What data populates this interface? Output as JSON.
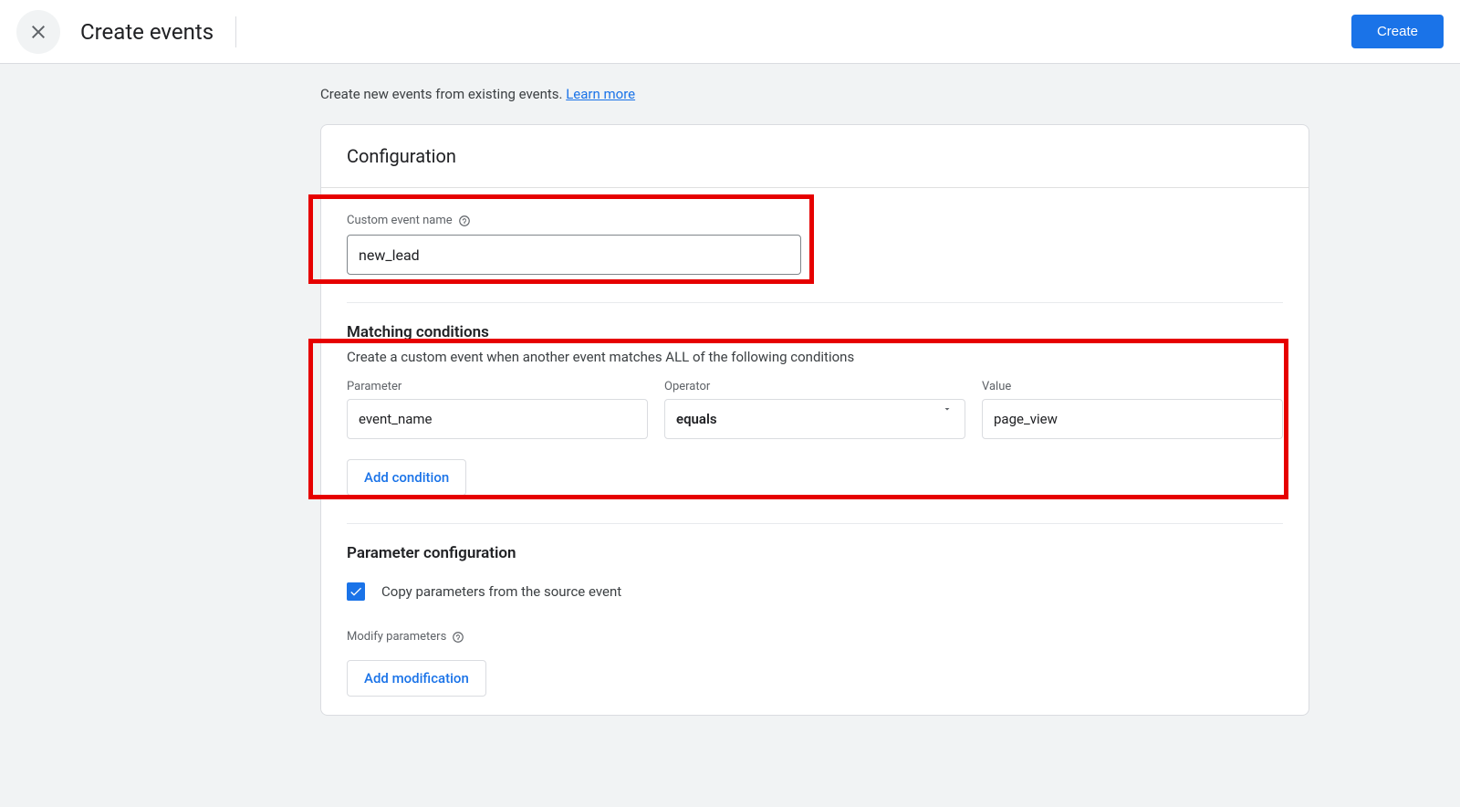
{
  "header": {
    "title": "Create events",
    "create_button": "Create"
  },
  "intro": {
    "text": "Create new events from existing events. ",
    "learn_more": "Learn more"
  },
  "card": {
    "title": "Configuration",
    "custom_event_label": "Custom event name",
    "custom_event_value": "new_lead",
    "matching": {
      "title": "Matching conditions",
      "subtitle": "Create a custom event when another event matches ALL of the following conditions",
      "param_label": "Parameter",
      "operator_label": "Operator",
      "value_label": "Value",
      "param_value": "event_name",
      "operator_value": "equals",
      "value_value": "page_view",
      "add_condition": "Add condition"
    },
    "param_config": {
      "title": "Parameter configuration",
      "copy_label": "Copy parameters from the source event",
      "modify_label": "Modify parameters",
      "add_modification": "Add modification"
    }
  }
}
